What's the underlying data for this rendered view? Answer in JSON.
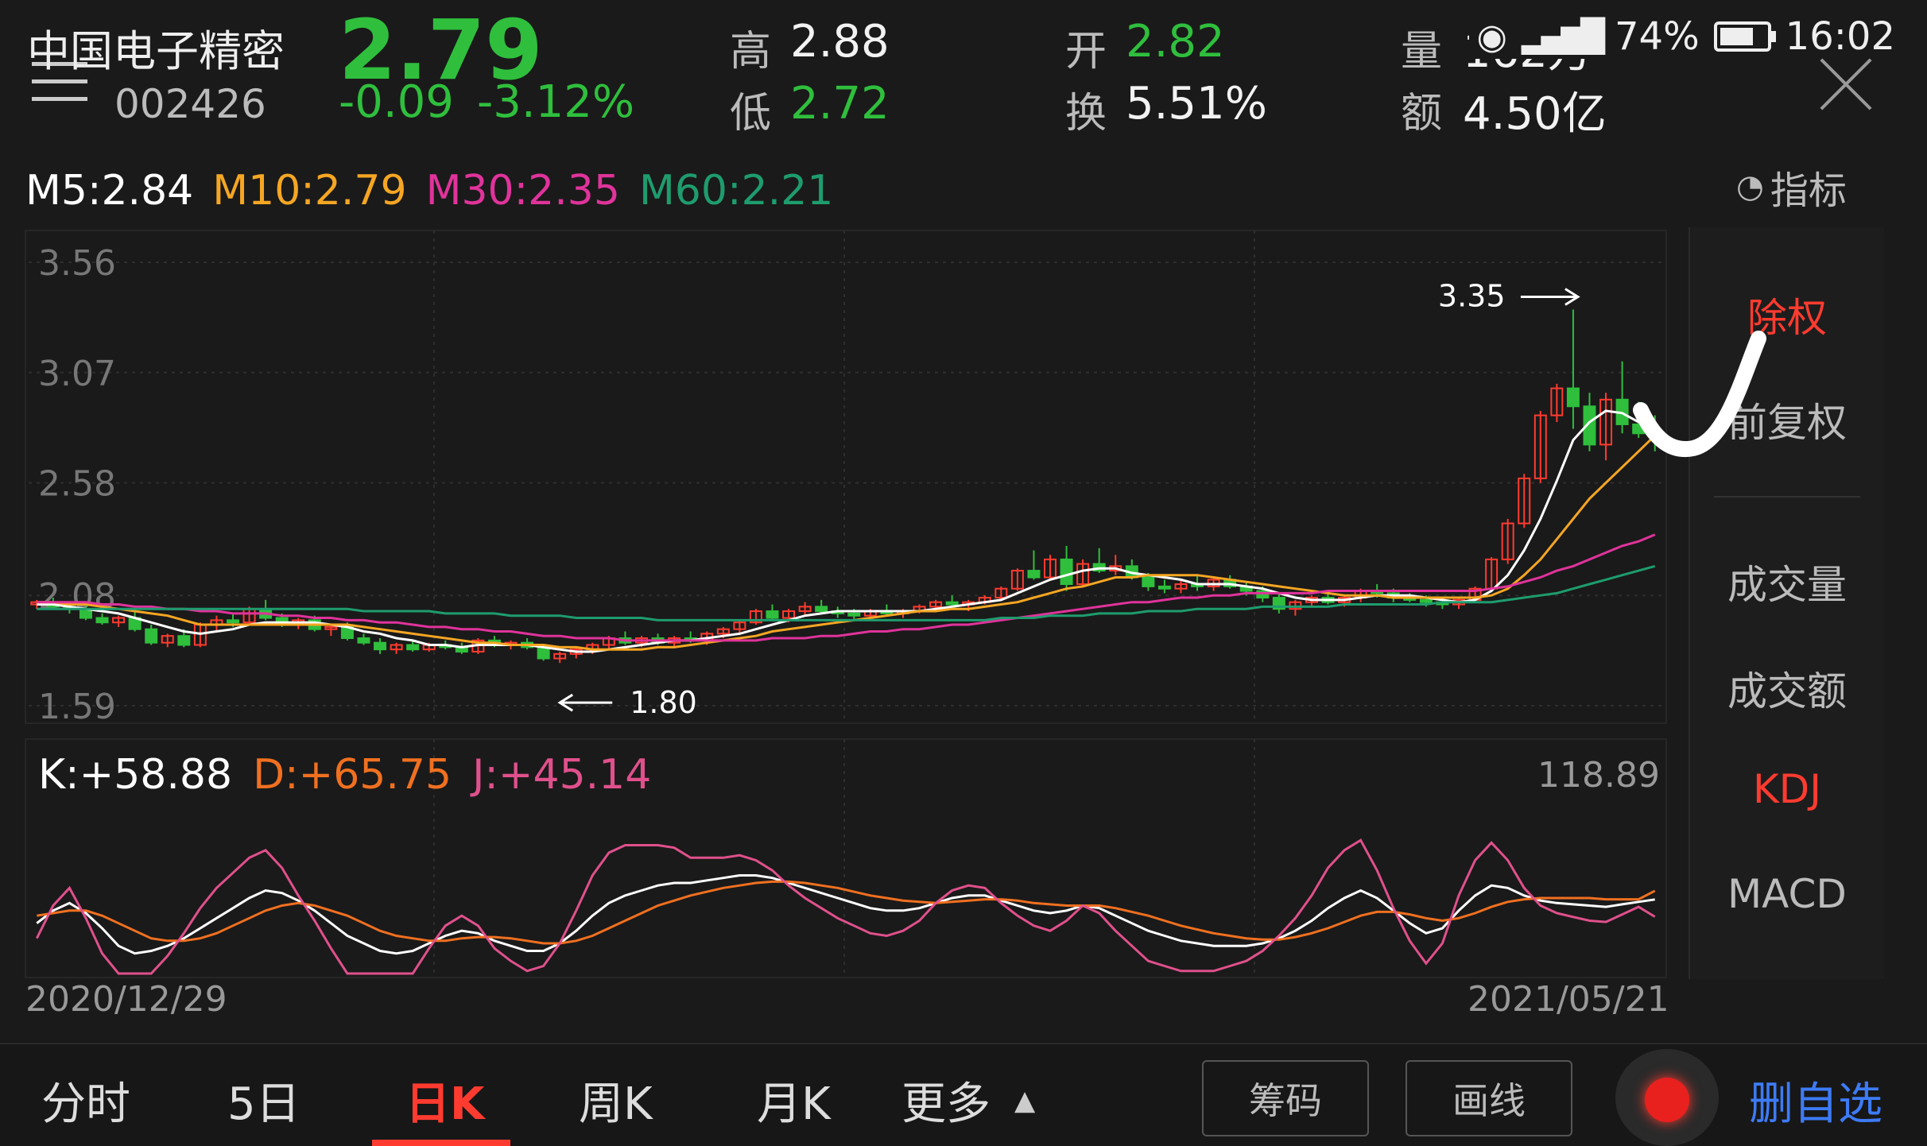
{
  "header": {
    "stock_name": "中国电子精密",
    "stock_code": "002426",
    "price": "2.79",
    "change": "-0.09",
    "change_pct": "-3.12%",
    "high_label": "高",
    "high": "2.88",
    "low_label": "低",
    "low": "2.72",
    "open_label": "开",
    "open": "2.82",
    "turnover_label": "换",
    "turnover": "5.51%",
    "volume_label": "量",
    "volume": "162万",
    "amount_label": "额",
    "amount": "4.50亿"
  },
  "status": {
    "battery": "74%",
    "time": "16:02",
    "battery_level": 0.74
  },
  "ma_legend": {
    "m5": "M5:2.84",
    "m10": "M10:2.79",
    "m30": "M30:2.35",
    "m60": "M60:2.21"
  },
  "indicator_button": "指标",
  "right_panel": {
    "items": [
      "除权",
      "前复权",
      "成交量",
      "成交额",
      "KDJ",
      "MACD"
    ]
  },
  "kdj_legend": {
    "k": "K:+58.88",
    "d": "D:+65.75",
    "j": "J:+45.14"
  },
  "date_start": "2020/12/29",
  "date_end": "2021/05/21",
  "bottom": {
    "tabs": [
      "分时",
      "5日",
      "日K",
      "周K",
      "月K",
      "更多"
    ],
    "active_tab": "日K",
    "btn_chips": "筹码",
    "btn_draw": "画线",
    "btn_watch": "删自选"
  },
  "colors": {
    "up": "#ff3b30",
    "down": "#2fbf3d",
    "m5": "#ffffff",
    "m10": "#f5a623",
    "m30": "#e0339b",
    "m60": "#1e9c6e",
    "k": "#ffffff",
    "d": "#f07020",
    "j": "#e0508c"
  },
  "chart_data": {
    "type": "candlestick",
    "price_ticks": [
      "3.56",
      "3.07",
      "2.58",
      "2.08",
      "1.59"
    ],
    "ylim": [
      1.59,
      3.56
    ],
    "marker_high": "3.35",
    "marker_low": "1.80",
    "kdj_max_label": "118.89",
    "candles": [
      [
        2.04,
        2.06,
        2.02,
        2.05
      ],
      [
        2.05,
        2.07,
        2.02,
        2.03
      ],
      [
        2.03,
        2.05,
        2.0,
        2.02
      ],
      [
        2.02,
        2.04,
        1.97,
        1.98
      ],
      [
        1.98,
        2.0,
        1.95,
        1.96
      ],
      [
        1.96,
        1.99,
        1.94,
        1.98
      ],
      [
        1.98,
        2.01,
        1.92,
        1.93
      ],
      [
        1.93,
        1.95,
        1.86,
        1.87
      ],
      [
        1.87,
        1.91,
        1.85,
        1.9
      ],
      [
        1.9,
        1.93,
        1.85,
        1.86
      ],
      [
        1.86,
        1.96,
        1.85,
        1.95
      ],
      [
        1.95,
        1.99,
        1.92,
        1.97
      ],
      [
        1.97,
        2.0,
        1.94,
        1.96
      ],
      [
        1.96,
        2.03,
        1.95,
        2.02
      ],
      [
        2.02,
        2.06,
        1.97,
        1.98
      ],
      [
        1.98,
        2.0,
        1.94,
        1.95
      ],
      [
        1.95,
        1.98,
        1.93,
        1.97
      ],
      [
        1.97,
        1.99,
        1.92,
        1.93
      ],
      [
        1.93,
        1.95,
        1.9,
        1.94
      ],
      [
        1.94,
        1.96,
        1.88,
        1.89
      ],
      [
        1.89,
        1.91,
        1.86,
        1.87
      ],
      [
        1.87,
        1.89,
        1.82,
        1.84
      ],
      [
        1.84,
        1.87,
        1.82,
        1.86
      ],
      [
        1.86,
        1.88,
        1.83,
        1.84
      ],
      [
        1.84,
        1.87,
        1.83,
        1.86
      ],
      [
        1.86,
        1.88,
        1.84,
        1.85
      ],
      [
        1.85,
        1.87,
        1.82,
        1.83
      ],
      [
        1.83,
        1.89,
        1.82,
        1.88
      ],
      [
        1.88,
        1.9,
        1.85,
        1.86
      ],
      [
        1.86,
        1.88,
        1.84,
        1.87
      ],
      [
        1.87,
        1.89,
        1.84,
        1.85
      ],
      [
        1.85,
        1.86,
        1.79,
        1.8
      ],
      [
        1.8,
        1.83,
        1.78,
        1.82
      ],
      [
        1.82,
        1.85,
        1.8,
        1.84
      ],
      [
        1.84,
        1.87,
        1.82,
        1.86
      ],
      [
        1.86,
        1.9,
        1.84,
        1.89
      ],
      [
        1.89,
        1.92,
        1.86,
        1.87
      ],
      [
        1.87,
        1.9,
        1.85,
        1.89
      ],
      [
        1.89,
        1.91,
        1.86,
        1.87
      ],
      [
        1.87,
        1.9,
        1.85,
        1.89
      ],
      [
        1.89,
        1.92,
        1.87,
        1.88
      ],
      [
        1.88,
        1.92,
        1.86,
        1.91
      ],
      [
        1.91,
        1.94,
        1.89,
        1.93
      ],
      [
        1.93,
        1.97,
        1.91,
        1.96
      ],
      [
        1.96,
        2.02,
        1.95,
        2.01
      ],
      [
        2.01,
        2.04,
        1.97,
        1.98
      ],
      [
        1.98,
        2.02,
        1.96,
        2.01
      ],
      [
        2.01,
        2.05,
        1.99,
        2.03
      ],
      [
        2.03,
        2.06,
        2.0,
        2.01
      ],
      [
        2.01,
        2.03,
        1.98,
        2.0
      ],
      [
        2.0,
        2.02,
        1.97,
        1.99
      ],
      [
        1.99,
        2.02,
        1.97,
        2.01
      ],
      [
        2.01,
        2.04,
        1.99,
        2.0
      ],
      [
        2.0,
        2.02,
        1.98,
        2.01
      ],
      [
        2.01,
        2.04,
        2.0,
        2.03
      ],
      [
        2.03,
        2.06,
        2.01,
        2.05
      ],
      [
        2.05,
        2.08,
        2.03,
        2.04
      ],
      [
        2.04,
        2.06,
        2.01,
        2.05
      ],
      [
        2.05,
        2.08,
        2.04,
        2.07
      ],
      [
        2.07,
        2.12,
        2.06,
        2.11
      ],
      [
        2.11,
        2.2,
        2.1,
        2.19
      ],
      [
        2.19,
        2.28,
        2.15,
        2.16
      ],
      [
        2.16,
        2.26,
        2.15,
        2.24
      ],
      [
        2.24,
        2.3,
        2.1,
        2.13
      ],
      [
        2.13,
        2.24,
        2.12,
        2.22
      ],
      [
        2.22,
        2.29,
        2.18,
        2.19
      ],
      [
        2.19,
        2.26,
        2.17,
        2.21
      ],
      [
        2.21,
        2.24,
        2.15,
        2.16
      ],
      [
        2.16,
        2.18,
        2.1,
        2.12
      ],
      [
        2.12,
        2.15,
        2.09,
        2.11
      ],
      [
        2.11,
        2.15,
        2.09,
        2.13
      ],
      [
        2.13,
        2.17,
        2.1,
        2.12
      ],
      [
        2.12,
        2.16,
        2.1,
        2.15
      ],
      [
        2.15,
        2.17,
        2.11,
        2.12
      ],
      [
        2.12,
        2.14,
        2.08,
        2.1
      ],
      [
        2.1,
        2.12,
        2.05,
        2.07
      ],
      [
        2.07,
        2.09,
        2.0,
        2.02
      ],
      [
        2.02,
        2.06,
        1.99,
        2.05
      ],
      [
        2.05,
        2.08,
        2.03,
        2.07
      ],
      [
        2.07,
        2.09,
        2.04,
        2.05
      ],
      [
        2.05,
        2.08,
        2.03,
        2.07
      ],
      [
        2.07,
        2.11,
        2.05,
        2.1
      ],
      [
        2.1,
        2.13,
        2.07,
        2.09
      ],
      [
        2.09,
        2.11,
        2.05,
        2.07
      ],
      [
        2.07,
        2.09,
        2.05,
        2.06
      ],
      [
        2.06,
        2.08,
        2.03,
        2.05
      ],
      [
        2.05,
        2.07,
        2.02,
        2.04
      ],
      [
        2.04,
        2.07,
        2.02,
        2.06
      ],
      [
        2.06,
        2.12,
        2.05,
        2.11
      ],
      [
        2.11,
        2.25,
        2.1,
        2.24
      ],
      [
        2.24,
        2.42,
        2.22,
        2.4
      ],
      [
        2.4,
        2.62,
        2.38,
        2.6
      ],
      [
        2.6,
        2.9,
        2.58,
        2.88
      ],
      [
        2.88,
        3.02,
        2.85,
        3.0
      ],
      [
        3.0,
        3.35,
        2.82,
        2.92
      ],
      [
        2.92,
        2.98,
        2.72,
        2.75
      ],
      [
        2.75,
        2.98,
        2.68,
        2.95
      ],
      [
        2.95,
        3.12,
        2.8,
        2.84
      ],
      [
        2.84,
        2.94,
        2.78,
        2.8
      ],
      [
        2.8,
        2.88,
        2.72,
        2.79
      ]
    ],
    "series": [
      {
        "name": "M5",
        "values": [
          2.04,
          2.04,
          2.03,
          2.02,
          2.01,
          2.0,
          1.98,
          1.96,
          1.94,
          1.92,
          1.91,
          1.92,
          1.93,
          1.95,
          1.96,
          1.96,
          1.96,
          1.96,
          1.95,
          1.94,
          1.92,
          1.91,
          1.89,
          1.88,
          1.86,
          1.86,
          1.85,
          1.86,
          1.86,
          1.86,
          1.86,
          1.85,
          1.84,
          1.83,
          1.83,
          1.84,
          1.85,
          1.86,
          1.87,
          1.88,
          1.88,
          1.89,
          1.9,
          1.91,
          1.93,
          1.95,
          1.97,
          1.99,
          2.0,
          2.01,
          2.01,
          2.01,
          2.01,
          2.01,
          2.01,
          2.02,
          2.03,
          2.04,
          2.05,
          2.06,
          2.09,
          2.12,
          2.15,
          2.17,
          2.19,
          2.2,
          2.2,
          2.18,
          2.17,
          2.16,
          2.15,
          2.13,
          2.13,
          2.13,
          2.12,
          2.11,
          2.09,
          2.07,
          2.06,
          2.06,
          2.06,
          2.07,
          2.08,
          2.08,
          2.08,
          2.07,
          2.06,
          2.05,
          2.06,
          2.1,
          2.17,
          2.28,
          2.42,
          2.59,
          2.77,
          2.85,
          2.9,
          2.89,
          2.85,
          2.84
        ]
      },
      {
        "name": "M10",
        "values": [
          2.05,
          2.05,
          2.04,
          2.04,
          2.03,
          2.02,
          2.01,
          2.0,
          1.99,
          1.97,
          1.95,
          1.95,
          1.95,
          1.95,
          1.95,
          1.95,
          1.95,
          1.95,
          1.95,
          1.95,
          1.94,
          1.93,
          1.92,
          1.91,
          1.9,
          1.89,
          1.88,
          1.87,
          1.87,
          1.86,
          1.86,
          1.86,
          1.85,
          1.85,
          1.84,
          1.84,
          1.84,
          1.84,
          1.85,
          1.85,
          1.86,
          1.87,
          1.88,
          1.89,
          1.9,
          1.92,
          1.93,
          1.94,
          1.95,
          1.96,
          1.97,
          1.98,
          1.99,
          2.0,
          2.01,
          2.01,
          2.02,
          2.02,
          2.03,
          2.04,
          2.05,
          2.07,
          2.09,
          2.11,
          2.12,
          2.14,
          2.16,
          2.16,
          2.17,
          2.17,
          2.17,
          2.17,
          2.16,
          2.15,
          2.14,
          2.13,
          2.12,
          2.11,
          2.1,
          2.09,
          2.08,
          2.08,
          2.08,
          2.07,
          2.07,
          2.07,
          2.07,
          2.07,
          2.07,
          2.08,
          2.11,
          2.17,
          2.24,
          2.33,
          2.42,
          2.51,
          2.58,
          2.65,
          2.72,
          2.79
        ]
      },
      {
        "name": "M30",
        "values": [
          2.05,
          2.05,
          2.05,
          2.05,
          2.04,
          2.04,
          2.03,
          2.03,
          2.02,
          2.02,
          2.01,
          2.01,
          2.0,
          2.0,
          2.0,
          1.99,
          1.99,
          1.98,
          1.98,
          1.97,
          1.97,
          1.96,
          1.96,
          1.95,
          1.94,
          1.94,
          1.93,
          1.93,
          1.92,
          1.92,
          1.91,
          1.9,
          1.9,
          1.89,
          1.89,
          1.89,
          1.88,
          1.88,
          1.88,
          1.88,
          1.88,
          1.88,
          1.88,
          1.88,
          1.88,
          1.89,
          1.89,
          1.89,
          1.9,
          1.9,
          1.91,
          1.92,
          1.92,
          1.93,
          1.93,
          1.94,
          1.95,
          1.95,
          1.96,
          1.97,
          1.98,
          1.99,
          2.0,
          2.01,
          2.02,
          2.03,
          2.04,
          2.05,
          2.05,
          2.06,
          2.07,
          2.07,
          2.08,
          2.08,
          2.09,
          2.09,
          2.09,
          2.09,
          2.09,
          2.1,
          2.1,
          2.1,
          2.1,
          2.1,
          2.1,
          2.1,
          2.1,
          2.1,
          2.1,
          2.11,
          2.12,
          2.14,
          2.16,
          2.19,
          2.21,
          2.24,
          2.27,
          2.3,
          2.32,
          2.35
        ]
      },
      {
        "name": "M60",
        "values": [
          2.02,
          2.02,
          2.02,
          2.02,
          2.02,
          2.02,
          2.02,
          2.02,
          2.02,
          2.02,
          2.02,
          2.02,
          2.02,
          2.02,
          2.02,
          2.02,
          2.02,
          2.02,
          2.02,
          2.02,
          2.01,
          2.01,
          2.01,
          2.01,
          2.01,
          2.0,
          2.0,
          2.0,
          2.0,
          1.99,
          1.99,
          1.99,
          1.99,
          1.98,
          1.98,
          1.98,
          1.98,
          1.98,
          1.97,
          1.97,
          1.97,
          1.97,
          1.97,
          1.97,
          1.97,
          1.97,
          1.97,
          1.97,
          1.97,
          1.97,
          1.97,
          1.97,
          1.97,
          1.97,
          1.97,
          1.97,
          1.97,
          1.97,
          1.97,
          1.98,
          1.98,
          1.98,
          1.99,
          1.99,
          1.99,
          2.0,
          2.0,
          2.0,
          2.01,
          2.01,
          2.01,
          2.02,
          2.02,
          2.02,
          2.02,
          2.03,
          2.03,
          2.03,
          2.03,
          2.03,
          2.04,
          2.04,
          2.04,
          2.04,
          2.04,
          2.04,
          2.05,
          2.05,
          2.05,
          2.05,
          2.06,
          2.07,
          2.08,
          2.09,
          2.11,
          2.13,
          2.15,
          2.17,
          2.19,
          2.21
        ]
      },
      {
        "name": "K",
        "values": [
          40,
          50,
          56,
          48,
          36,
          22,
          16,
          18,
          22,
          28,
          36,
          44,
          52,
          60,
          66,
          64,
          58,
          50,
          40,
          30,
          24,
          18,
          16,
          18,
          24,
          30,
          34,
          32,
          26,
          22,
          18,
          18,
          24,
          34,
          46,
          56,
          62,
          66,
          70,
          72,
          72,
          74,
          76,
          78,
          78,
          76,
          72,
          68,
          64,
          60,
          56,
          52,
          50,
          50,
          52,
          56,
          60,
          62,
          62,
          58,
          54,
          50,
          48,
          50,
          54,
          52,
          46,
          40,
          34,
          30,
          26,
          24,
          22,
          22,
          22,
          24,
          28,
          34,
          42,
          52,
          60,
          66,
          60,
          50,
          40,
          32,
          36,
          50,
          62,
          70,
          68,
          62,
          58,
          56,
          55,
          54,
          53,
          55,
          57,
          58.88
        ]
      },
      {
        "name": "D",
        "values": [
          46,
          48,
          50,
          50,
          46,
          40,
          34,
          28,
          26,
          26,
          28,
          32,
          38,
          44,
          50,
          54,
          56,
          54,
          50,
          46,
          40,
          34,
          30,
          28,
          26,
          26,
          28,
          29,
          29,
          28,
          26,
          24,
          24,
          26,
          30,
          36,
          42,
          48,
          54,
          58,
          62,
          65,
          68,
          70,
          72,
          73,
          73,
          72,
          70,
          68,
          65,
          62,
          60,
          58,
          57,
          56,
          57,
          58,
          59,
          59,
          58,
          56,
          55,
          54,
          54,
          54,
          52,
          49,
          46,
          42,
          38,
          35,
          32,
          30,
          28,
          27,
          27,
          29,
          32,
          36,
          41,
          46,
          49,
          49,
          47,
          44,
          42,
          44,
          48,
          53,
          57,
          59,
          60,
          60,
          60,
          60,
          59,
          59,
          59,
          65.75
        ]
      },
      {
        "name": "J",
        "values": [
          28,
          54,
          68,
          44,
          16,
          0,
          0,
          0,
          14,
          32,
          52,
          68,
          80,
          92,
          98,
          84,
          62,
          42,
          20,
          0,
          0,
          0,
          0,
          0,
          20,
          38,
          46,
          38,
          20,
          10,
          2,
          6,
          24,
          50,
          78,
          96,
          102,
          102,
          102,
          100,
          92,
          92,
          92,
          94,
          90,
          82,
          70,
          60,
          52,
          44,
          38,
          32,
          30,
          34,
          42,
          56,
          66,
          70,
          68,
          56,
          46,
          38,
          34,
          42,
          54,
          48,
          34,
          22,
          10,
          6,
          2,
          2,
          2,
          6,
          10,
          18,
          30,
          44,
          62,
          84,
          98,
          106,
          82,
          52,
          26,
          8,
          24,
          62,
          90,
          104,
          90,
          68,
          54,
          48,
          45,
          42,
          41,
          47,
          53,
          45.14
        ]
      }
    ]
  }
}
